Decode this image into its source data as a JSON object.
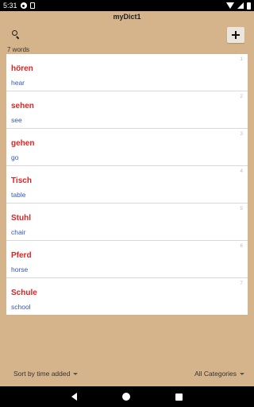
{
  "status_bar": {
    "time": "5:31"
  },
  "app": {
    "title": "myDict1"
  },
  "word_count": "7 words",
  "words": [
    {
      "term": "hören",
      "meaning": "hear",
      "index": "1"
    },
    {
      "term": "sehen",
      "meaning": "see",
      "index": "2"
    },
    {
      "term": "gehen",
      "meaning": "go",
      "index": "3"
    },
    {
      "term": "Tisch",
      "meaning": "table",
      "index": "4"
    },
    {
      "term": "Stuhl",
      "meaning": "chair",
      "index": "5"
    },
    {
      "term": "Pferd",
      "meaning": "horse",
      "index": "6"
    },
    {
      "term": "Schule",
      "meaning": "school",
      "index": "7"
    }
  ],
  "bottom_bar": {
    "sort_label": "Sort by time added",
    "category_label": "All Categories"
  },
  "colors": {
    "background": "#d5b48c",
    "term": "#dd2222",
    "meaning": "#3355bb"
  },
  "icons": [
    "search-icon",
    "plus-icon",
    "caret-down-icon",
    "back-icon",
    "home-icon",
    "recents-icon"
  ]
}
